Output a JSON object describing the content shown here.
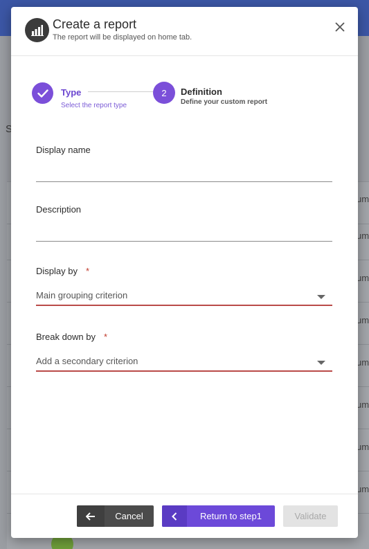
{
  "background": {
    "partial_letter": "S",
    "column_cell_text": "um"
  },
  "modal": {
    "title": "Create a report",
    "subtitle": "The report will be displayed on home tab."
  },
  "stepper": {
    "steps": [
      {
        "label": "Type",
        "description": "Select the report type",
        "state": "completed"
      },
      {
        "number": "2",
        "label": "Definition",
        "description": "Define your custom report",
        "state": "active"
      }
    ]
  },
  "form": {
    "display_name": {
      "label": "Display name",
      "value": ""
    },
    "description": {
      "label": "Description",
      "value": ""
    },
    "display_by": {
      "label": "Display by",
      "required_marker": "*",
      "placeholder": "Main grouping criterion"
    },
    "break_down_by": {
      "label": "Break down by",
      "required_marker": "*",
      "placeholder": "Add a secondary criterion"
    }
  },
  "footer": {
    "cancel_label": "Cancel",
    "back_label": "Return to step1",
    "validate_label": "Validate"
  },
  "colors": {
    "accent": "#7b4fd9",
    "error": "#b94a48",
    "dark_button": "#4b4b4b"
  }
}
